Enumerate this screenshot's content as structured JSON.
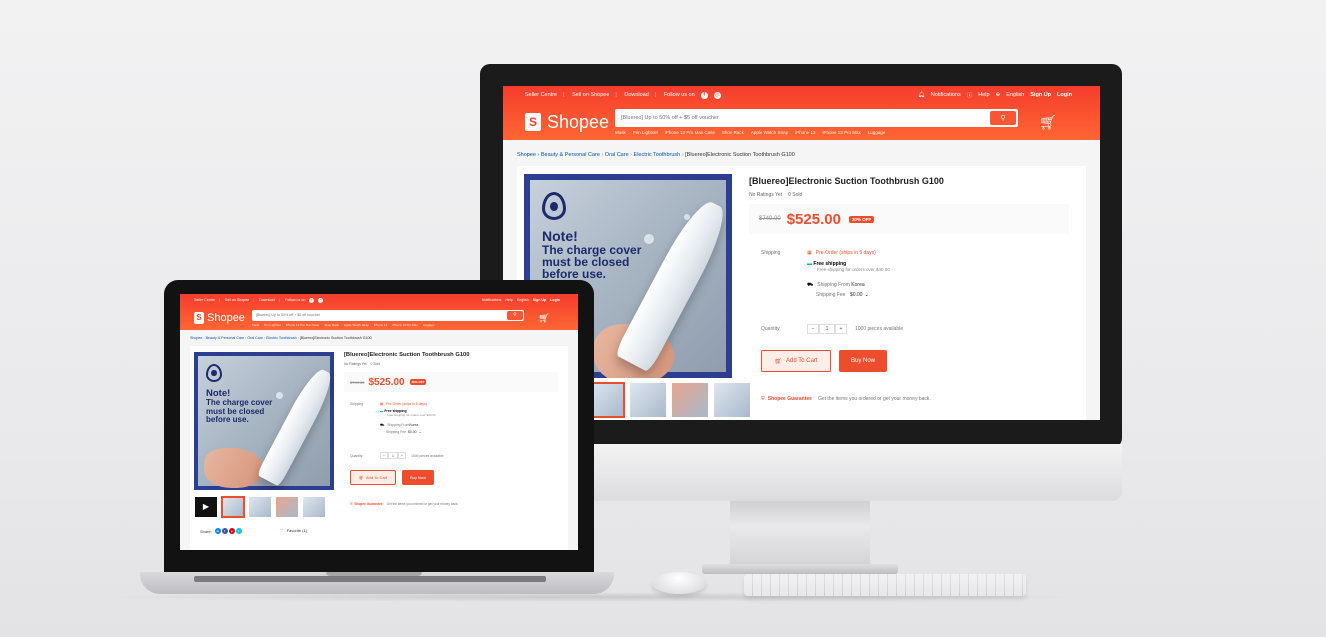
{
  "shop": {
    "nav_left": [
      "Seller Centre",
      "Sell on Shopee",
      "Download",
      "Follow us on"
    ],
    "nav_right": [
      "Notifications",
      "Help",
      "English",
      "Sign Up",
      "Login"
    ],
    "logo_text": "Shopee",
    "logo_letter": "S",
    "search_placeholder": "[Bluereo] Up to 50% off + $5 off voucher",
    "search_hints": [
      "Mask",
      "Pen Lightset",
      "iPhone 12 Pro Max Case",
      "Shoe Rack",
      "Apple Watch Strap",
      "iPhone 13",
      "iPhone 13 Pro Max",
      "Luggage"
    ],
    "breadcrumb": [
      "Shopee",
      "Beauty & Personal Care",
      "Oral Care",
      "Electric Toothbrush",
      "[Bluereo]Electronic Suction Toothbrush G100"
    ],
    "note_title": "Note!",
    "note_body": "The charge cover must be closed before use.",
    "product_title": "[Bluereo]Electronic Suction Toothbrush G100",
    "ratings": "No Ratings Yet",
    "sold": "0 Sold",
    "old_price": "$749.00",
    "price": "$525.00",
    "discount": "30% OFF",
    "shipping_label": "Shipping",
    "preorder": "Pre-Order (ships in 5 days)",
    "free_shipping": "Free shipping",
    "free_shipping_sub": "Free shipping for orders over $40.00",
    "ship_from_label": "Shipping From",
    "ship_from": "Korea",
    "ship_fee_label": "Shipping Fee",
    "ship_fee": "$0.00",
    "quantity_label": "Quantity",
    "qty_minus": "−",
    "qty_value": "1",
    "qty_plus": "+",
    "available": "1000 pieces available",
    "add_to_cart": "Add To Cart",
    "buy_now": "Buy Now",
    "guarantee": "Shopee Guarantee",
    "guarantee_sub": "Get the items you ordered or get your money back.",
    "share": "Share:",
    "favorite": "Favorite (1)"
  },
  "colors": {
    "brand": "#ee4d2d",
    "frame": "#2c3e8f"
  },
  "icons": [
    "bell-icon",
    "help-icon",
    "globe-icon",
    "search-icon",
    "cart-icon",
    "heart-icon",
    "shield-icon",
    "truck-icon"
  ]
}
